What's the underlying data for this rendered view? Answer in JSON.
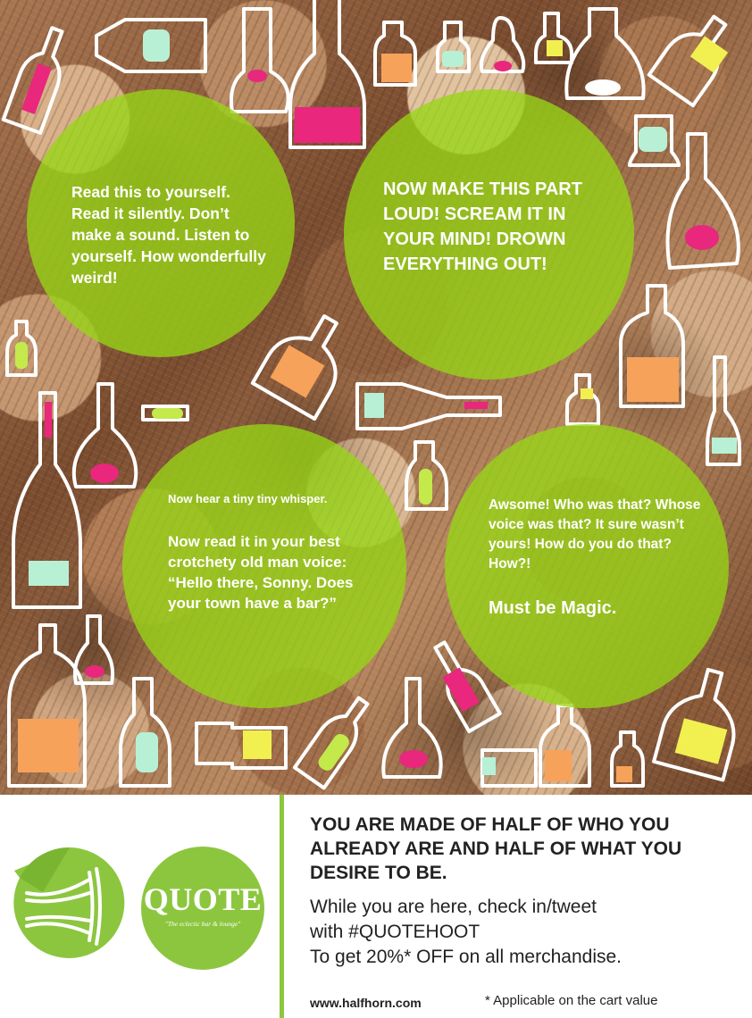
{
  "bubbles": {
    "one": "Read this to yourself. Read it silently. Don’t make a sound. Listen to yourself. How wonderfully weird!",
    "two": "NOW MAKE THIS PART LOUD! SCREAM IT IN YOUR MIND! DROWN EVERYTHING OUT!",
    "three_small": "Now hear a tiny tiny whisper.",
    "three": "Now read it in your best crotchety old man voice: “Hello there, Sonny. Does your town have a bar?”",
    "four": "Awsome! Who was that? Whose voice was that? It sure wasn’t yours! How do you do that? How?!",
    "four_emphasis": "Must be Magic."
  },
  "footer": {
    "headline": "YOU ARE MADE OF HALF OF WHO YOU ALREADY ARE AND HALF OF WHAT YOU DESIRE TO BE.",
    "promo_line1": "While you are here, check in/tweet",
    "promo_line2": "with #QUOTEHOOT",
    "promo_line3": "To get 20%* OFF on all merchandise.",
    "website": "www.halfhorn.com",
    "disclaimer": "* Applicable on the cart value"
  },
  "logos": {
    "horn_icon": "horn-icon",
    "quote_word": "QUOTE",
    "quote_tagline": "\"The eclectic bar & lounge\""
  },
  "colors": {
    "bubble_green": "#97d616",
    "logo_green": "#8cc63f",
    "accent_pink": "#e8277d",
    "accent_orange": "#f7a25a",
    "accent_yellow": "#f2f051",
    "accent_mint": "#b8f0d6"
  }
}
